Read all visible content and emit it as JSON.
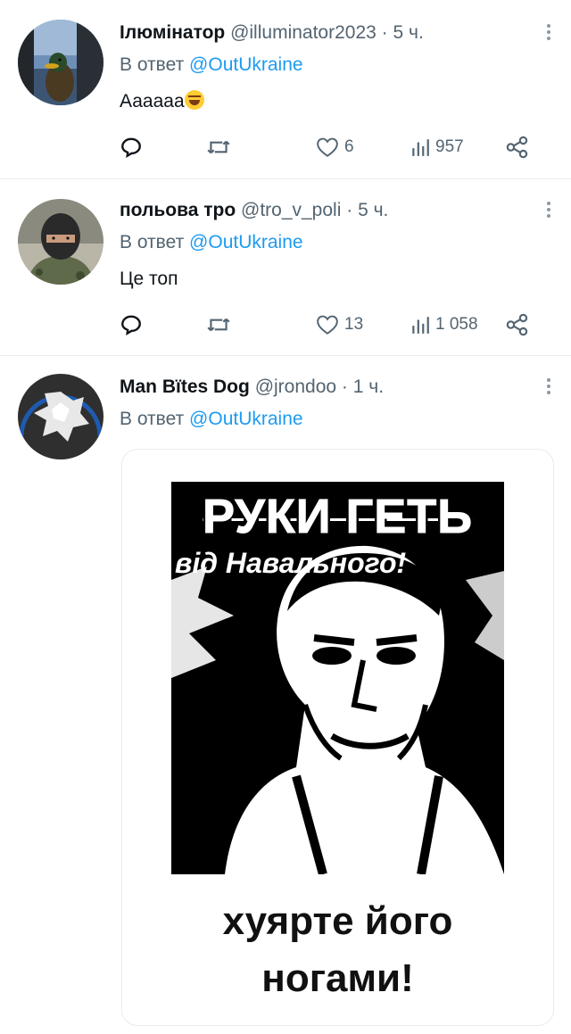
{
  "tweets": [
    {
      "name": "Ілюмінатор",
      "handle": "@illuminator2023",
      "sep": "·",
      "time": "5 ч.",
      "reply_prefix": "В ответ",
      "reply_to": "@OutUkraine",
      "text": "Аааааа",
      "text_emoji": "rolling-on-floor-laughing-emoji",
      "likes": "6",
      "views": "957"
    },
    {
      "name": "польова тро",
      "handle": "@tro_v_poli",
      "sep": "·",
      "time": "5 ч.",
      "reply_prefix": "В ответ",
      "reply_to": "@OutUkraine",
      "text": "Це топ",
      "likes": "13",
      "views": "1 058"
    },
    {
      "name": "Man Bïtes Dog",
      "handle": "@jrondoo",
      "sep": "·",
      "time": "1 ч.",
      "reply_prefix": "В ответ",
      "reply_to": "@OutUkraine",
      "media": {
        "title": "РУКИ ГЕТЬ",
        "subtitle": "від Навального!",
        "caption_line1": "хуярте його",
        "caption_line2": "ногами!"
      }
    }
  ],
  "icons": [
    "reply-icon",
    "retweet-icon",
    "like-icon",
    "views-icon",
    "share-icon",
    "more-icon"
  ],
  "colors": {
    "link": "#1d9bf0",
    "secondary": "#536471",
    "text": "#0f1419",
    "divider": "#e6ecf0"
  }
}
